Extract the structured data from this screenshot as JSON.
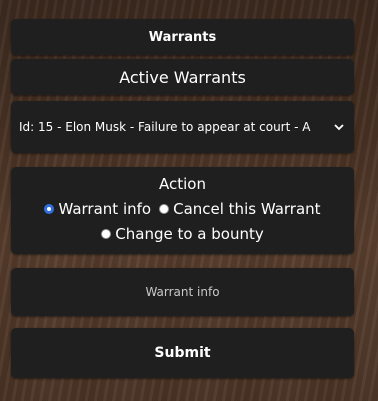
{
  "header": {
    "title": "Warrants",
    "subtitle": "Active Warrants"
  },
  "warrant_select": {
    "selected": "Id: 15 - Elon Musk - Failure to appear at court - A",
    "icon": "chevron-down-icon"
  },
  "action": {
    "title": "Action",
    "options": [
      {
        "label": "Warrant info",
        "checked": true
      },
      {
        "label": "Cancel this Warrant",
        "checked": false
      },
      {
        "label": "Change to a bounty",
        "checked": false
      }
    ]
  },
  "info_panel": {
    "text": "Warrant info"
  },
  "submit": {
    "label": "Submit"
  },
  "colors": {
    "panel": "#1f1f1f",
    "radio_accent": "#2f6fe0",
    "text": "#ffffff"
  }
}
